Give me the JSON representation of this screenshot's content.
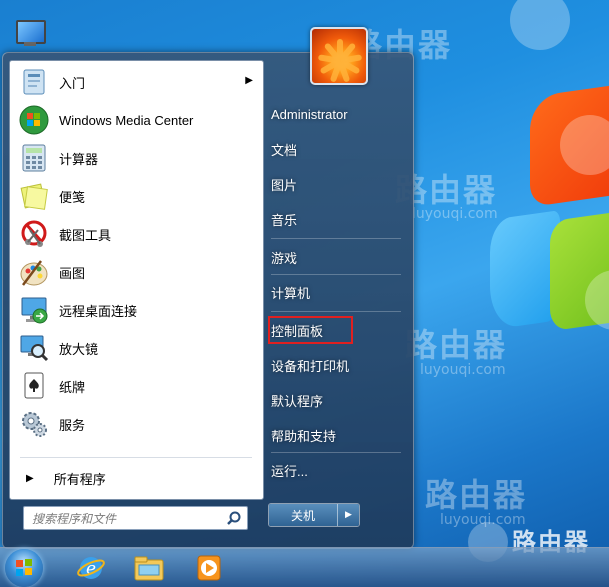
{
  "desktop": {
    "watermark_brand": "路由器",
    "watermark_url": "luyouqi.com"
  },
  "start_menu": {
    "programs": [
      {
        "label": "入门",
        "icon": "getting-started-icon",
        "has_submenu": true
      },
      {
        "label": "Windows Media Center",
        "icon": "media-center-icon",
        "has_submenu": false
      },
      {
        "label": "计算器",
        "icon": "calculator-icon",
        "has_submenu": false
      },
      {
        "label": "便笺",
        "icon": "sticky-notes-icon",
        "has_submenu": false
      },
      {
        "label": "截图工具",
        "icon": "snipping-tool-icon",
        "has_submenu": false
      },
      {
        "label": "画图",
        "icon": "paint-icon",
        "has_submenu": false
      },
      {
        "label": "远程桌面连接",
        "icon": "remote-desktop-icon",
        "has_submenu": false
      },
      {
        "label": "放大镜",
        "icon": "magnifier-icon",
        "has_submenu": false
      },
      {
        "label": "纸牌",
        "icon": "solitaire-icon",
        "has_submenu": false
      },
      {
        "label": "服务",
        "icon": "services-icon",
        "has_submenu": false
      }
    ],
    "all_programs_label": "所有程序",
    "search_placeholder": "搜索程序和文件",
    "right_items": [
      {
        "label": "Administrator"
      },
      {
        "label": "文档"
      },
      {
        "label": "图片"
      },
      {
        "label": "音乐"
      },
      {
        "label": "游戏"
      },
      {
        "label": "计算机"
      },
      {
        "label": "控制面板"
      },
      {
        "label": "设备和打印机"
      },
      {
        "label": "默认程序"
      },
      {
        "label": "帮助和支持"
      },
      {
        "label": "运行..."
      }
    ],
    "highlighted_item": "控制面板",
    "highlight_color": "#e02020",
    "shutdown_label": "关机"
  },
  "taskbar": {
    "pinned": [
      {
        "icon": "internet-explorer-icon"
      },
      {
        "icon": "windows-explorer-icon"
      },
      {
        "icon": "media-player-icon"
      }
    ]
  }
}
